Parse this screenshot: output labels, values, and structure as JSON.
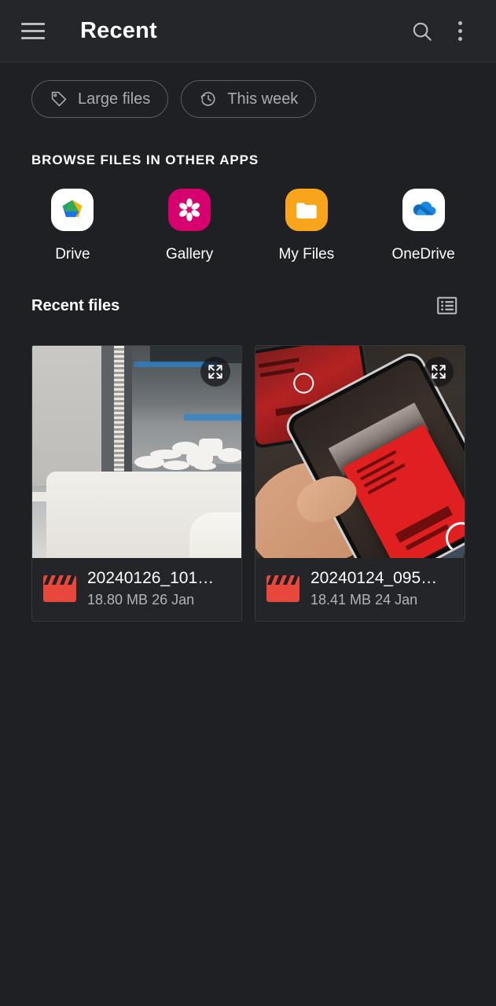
{
  "appbar": {
    "menu_icon": "hamburger-menu-icon",
    "title": "Recent",
    "search_icon": "search-icon",
    "overflow_icon": "more-vertical-icon"
  },
  "filters": {
    "chips": [
      {
        "label": "Large files",
        "icon": "tag-icon"
      },
      {
        "label": "This week",
        "icon": "history-clock-icon"
      }
    ]
  },
  "browse_section": {
    "title": "BROWSE FILES IN OTHER APPS",
    "apps": [
      {
        "label": "Drive",
        "icon": "google-drive-icon"
      },
      {
        "label": "Gallery",
        "icon": "gallery-flower-icon"
      },
      {
        "label": "My Files",
        "icon": "my-files-folder-icon"
      },
      {
        "label": "OneDrive",
        "icon": "onedrive-cloud-icon"
      }
    ]
  },
  "recent_section": {
    "title": "Recent files",
    "view_toggle_icon": "list-view-icon",
    "files": [
      {
        "name": "20240126_101…",
        "size": "18.80 MB",
        "date": "26 Jan",
        "type_icon": "video-clapperboard-icon",
        "overlay_icon": "expand-fullscreen-icon"
      },
      {
        "name": "20240124_095…",
        "size": "18.41 MB",
        "date": "24 Jan",
        "type_icon": "video-clapperboard-icon",
        "overlay_icon": "expand-fullscreen-icon"
      }
    ]
  },
  "colors": {
    "background": "#1e2023",
    "appbar": "#24262a",
    "card": "#232528",
    "text_primary": "#ffffff",
    "text_secondary": "#b1b4b9",
    "chip_border": "#5a5d63",
    "video_icon": "#e8473c",
    "gallery": "#d6006e",
    "my_files": "#f8a51b"
  }
}
